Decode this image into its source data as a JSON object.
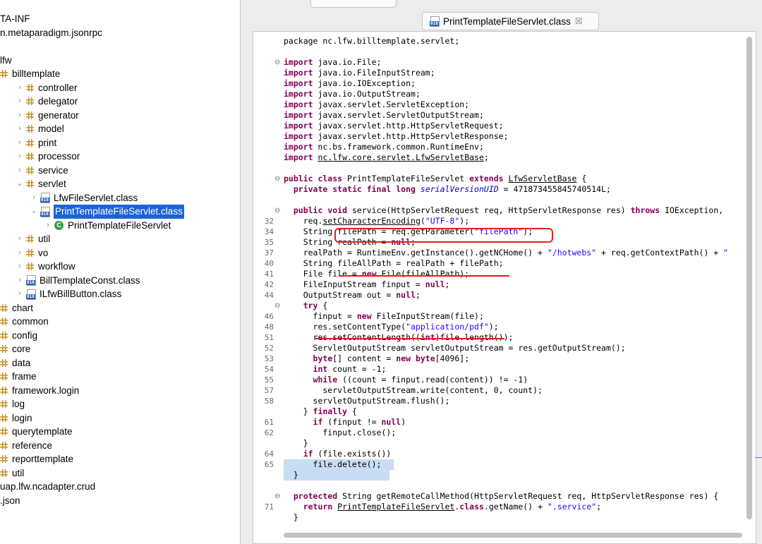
{
  "explorer": {
    "items": [
      {
        "label": "TA-INF",
        "indent": 0,
        "chev": "",
        "icon": "none"
      },
      {
        "label": "n.metaparadigm.jsonrpc",
        "indent": 0,
        "chev": "",
        "icon": "none"
      },
      {
        "label": "",
        "indent": 0,
        "chev": "",
        "icon": "none"
      },
      {
        "label": "lfw",
        "indent": 0,
        "chev": "",
        "icon": "none"
      },
      {
        "label": "billtemplate",
        "indent": 0,
        "chev": "",
        "icon": "pkg"
      },
      {
        "label": "controller",
        "indent": 1,
        "chev": ">",
        "icon": "pkg"
      },
      {
        "label": "delegator",
        "indent": 1,
        "chev": ">",
        "icon": "pkg"
      },
      {
        "label": "generator",
        "indent": 1,
        "chev": ">",
        "icon": "pkg"
      },
      {
        "label": "model",
        "indent": 1,
        "chev": ">",
        "icon": "pkg"
      },
      {
        "label": "print",
        "indent": 1,
        "chev": ">",
        "icon": "pkg"
      },
      {
        "label": "processor",
        "indent": 1,
        "chev": ">",
        "icon": "pkg"
      },
      {
        "label": "service",
        "indent": 1,
        "chev": ">",
        "icon": "pkg"
      },
      {
        "label": "servlet",
        "indent": 1,
        "chev": "v",
        "icon": "pkg"
      },
      {
        "label": "LfwFileServlet.class",
        "indent": 2,
        "chev": ">",
        "icon": "class"
      },
      {
        "label": "PrintTemplateFileServlet.class",
        "indent": 2,
        "chev": "v",
        "icon": "class",
        "selected": true
      },
      {
        "label": "PrintTemplateFileServlet",
        "indent": 3,
        "chev": ">",
        "icon": "cls"
      },
      {
        "label": "util",
        "indent": 1,
        "chev": ">",
        "icon": "pkg"
      },
      {
        "label": "vo",
        "indent": 1,
        "chev": ">",
        "icon": "pkg"
      },
      {
        "label": "workflow",
        "indent": 1,
        "chev": ">",
        "icon": "pkg"
      },
      {
        "label": "BillTemplateConst.class",
        "indent": 1,
        "chev": ">",
        "icon": "class"
      },
      {
        "label": "ILfwBillButton.class",
        "indent": 1,
        "chev": ">",
        "icon": "class"
      },
      {
        "label": "chart",
        "indent": 0,
        "chev": "",
        "icon": "pkg"
      },
      {
        "label": "common",
        "indent": 0,
        "chev": "",
        "icon": "pkg"
      },
      {
        "label": "config",
        "indent": 0,
        "chev": "",
        "icon": "pkg"
      },
      {
        "label": "core",
        "indent": 0,
        "chev": "",
        "icon": "pkg"
      },
      {
        "label": "data",
        "indent": 0,
        "chev": "",
        "icon": "pkg"
      },
      {
        "label": "frame",
        "indent": 0,
        "chev": "",
        "icon": "pkg"
      },
      {
        "label": "framework.login",
        "indent": 0,
        "chev": "",
        "icon": "pkg"
      },
      {
        "label": "log",
        "indent": 0,
        "chev": "",
        "icon": "pkg"
      },
      {
        "label": "login",
        "indent": 0,
        "chev": "",
        "icon": "pkg"
      },
      {
        "label": "querytemplate",
        "indent": 0,
        "chev": "",
        "icon": "pkg"
      },
      {
        "label": "reference",
        "indent": 0,
        "chev": "",
        "icon": "pkg"
      },
      {
        "label": "reporttemplate",
        "indent": 0,
        "chev": "",
        "icon": "pkg"
      },
      {
        "label": "util",
        "indent": 0,
        "chev": "",
        "icon": "pkg"
      },
      {
        "label": "uap.lfw.ncadapter.crud",
        "indent": 0,
        "chev": "",
        "icon": "none"
      },
      {
        "label": ".json",
        "indent": 0,
        "chev": "",
        "icon": "none"
      }
    ]
  },
  "editor": {
    "tab_label": "PrintTemplateFileServlet.class",
    "tab_close": "☒",
    "lines": [
      {
        "n": "",
        "fold": "",
        "code": [
          [
            "",
            "package nc.lfw.billtemplate.servlet;"
          ]
        ]
      },
      {
        "n": "",
        "fold": "",
        "code": []
      },
      {
        "n": "",
        "fold": "⊖",
        "code": [
          [
            "kw",
            "import"
          ],
          [
            "",
            " java.io.File;"
          ]
        ]
      },
      {
        "n": "",
        "fold": "",
        "code": [
          [
            "kw",
            "import"
          ],
          [
            "",
            " java.io.FileInputStream;"
          ]
        ]
      },
      {
        "n": "",
        "fold": "",
        "code": [
          [
            "kw",
            "import"
          ],
          [
            "",
            " java.io.IOException;"
          ]
        ]
      },
      {
        "n": "",
        "fold": "",
        "code": [
          [
            "kw",
            "import"
          ],
          [
            "",
            " java.io.OutputStream;"
          ]
        ]
      },
      {
        "n": "",
        "fold": "",
        "code": [
          [
            "kw",
            "import"
          ],
          [
            "",
            " javax.servlet.ServletException;"
          ]
        ]
      },
      {
        "n": "",
        "fold": "",
        "code": [
          [
            "kw",
            "import"
          ],
          [
            "",
            " javax.servlet.ServletOutputStream;"
          ]
        ]
      },
      {
        "n": "",
        "fold": "",
        "code": [
          [
            "kw",
            "import"
          ],
          [
            "",
            " javax.servlet.http.HttpServletRequest;"
          ]
        ]
      },
      {
        "n": "",
        "fold": "",
        "code": [
          [
            "kw",
            "import"
          ],
          [
            "",
            " javax.servlet.http.HttpServletResponse;"
          ]
        ]
      },
      {
        "n": "",
        "fold": "",
        "code": [
          [
            "kw",
            "import"
          ],
          [
            "",
            " nc.bs.framework.common.RuntimeEnv;"
          ]
        ]
      },
      {
        "n": "",
        "fold": "",
        "code": [
          [
            "kw",
            "import"
          ],
          [
            "",
            " "
          ],
          [
            "ul",
            "nc.lfw.core.servlet.LfwServletBase"
          ],
          [
            "",
            ";"
          ]
        ]
      },
      {
        "n": "",
        "fold": "",
        "code": []
      },
      {
        "n": "",
        "fold": "⊖",
        "code": [
          [
            "kw",
            "public class"
          ],
          [
            "",
            " PrintTemplateFileServlet "
          ],
          [
            "kw",
            "extends"
          ],
          [
            "",
            " "
          ],
          [
            "ul",
            "LfwServletBase"
          ],
          [
            "",
            " {"
          ]
        ]
      },
      {
        "n": "",
        "fold": "",
        "code": [
          [
            "",
            "  "
          ],
          [
            "kw",
            "private static final long"
          ],
          [
            "",
            " "
          ],
          [
            "fld",
            "serialVersionUID"
          ],
          [
            "",
            " = 471873455845740514L;"
          ]
        ]
      },
      {
        "n": "",
        "fold": "",
        "code": []
      },
      {
        "n": "",
        "fold": "⊖",
        "code": [
          [
            "",
            "  "
          ],
          [
            "kw",
            "public void"
          ],
          [
            "",
            " service(HttpServletRequest req, HttpServletResponse res) "
          ],
          [
            "kw",
            "throws"
          ],
          [
            "",
            " IOException,"
          ]
        ]
      },
      {
        "n": "32",
        "fold": "",
        "code": [
          [
            "",
            "    req."
          ],
          [
            "ul",
            "setCharacterEncoding"
          ],
          [
            "",
            "("
          ],
          [
            "str",
            "\"UTF-8\""
          ],
          [
            "",
            ");"
          ]
        ]
      },
      {
        "n": "34",
        "fold": "",
        "code": [
          [
            "",
            "    String filePath = req.getParameter("
          ],
          [
            "str",
            "\"filePath\""
          ],
          [
            "",
            ");"
          ]
        ]
      },
      {
        "n": "35",
        "fold": "",
        "code": [
          [
            "",
            "    String realPath = "
          ],
          [
            "kw",
            "null"
          ],
          [
            "",
            ";"
          ]
        ]
      },
      {
        "n": "37",
        "fold": "",
        "code": [
          [
            "",
            "    realPath = RuntimeEnv.getInstance().getNCHome() + "
          ],
          [
            "str",
            "\"/hotwebs\""
          ],
          [
            "",
            " + req.getContextPath() + "
          ],
          [
            "str",
            "\""
          ]
        ]
      },
      {
        "n": "40",
        "fold": "",
        "code": [
          [
            "",
            "    String fileAllPath = realPath + filePath;"
          ]
        ]
      },
      {
        "n": "41",
        "fold": "",
        "code": [
          [
            "",
            "    File file = "
          ],
          [
            "kw",
            "new"
          ],
          [
            "",
            " File(fileAllPath);"
          ]
        ]
      },
      {
        "n": "42",
        "fold": "",
        "code": [
          [
            "",
            "    FileInputStream finput = "
          ],
          [
            "kw",
            "null"
          ],
          [
            "",
            ";"
          ]
        ]
      },
      {
        "n": "44",
        "fold": "",
        "code": [
          [
            "",
            "    OutputStream out = "
          ],
          [
            "kw",
            "null"
          ],
          [
            "",
            ";"
          ]
        ]
      },
      {
        "n": "",
        "fold": "⊖",
        "code": [
          [
            "",
            "    "
          ],
          [
            "kw",
            "try"
          ],
          [
            "",
            " {"
          ]
        ]
      },
      {
        "n": "46",
        "fold": "",
        "code": [
          [
            "",
            "      finput = "
          ],
          [
            "kw",
            "new"
          ],
          [
            "",
            " FileInputStream(file);"
          ]
        ]
      },
      {
        "n": "48",
        "fold": "",
        "code": [
          [
            "",
            "      res.setContentType("
          ],
          [
            "str",
            "\"application/pdf\""
          ],
          [
            "",
            ");"
          ]
        ]
      },
      {
        "n": "51",
        "fold": "",
        "code": [
          [
            "",
            "      res.setContentLength(("
          ],
          [
            "kw",
            "int"
          ],
          [
            "",
            ")file.length());"
          ]
        ]
      },
      {
        "n": "52",
        "fold": "",
        "code": [
          [
            "",
            "      ServletOutputStream servletOutputStream = res.getOutputStream();"
          ]
        ]
      },
      {
        "n": "53",
        "fold": "",
        "code": [
          [
            "",
            "      "
          ],
          [
            "kw",
            "byte"
          ],
          [
            "",
            "[] content = "
          ],
          [
            "kw",
            "new byte"
          ],
          [
            "",
            "[4096];"
          ]
        ]
      },
      {
        "n": "54",
        "fold": "",
        "code": [
          [
            "",
            "      "
          ],
          [
            "kw",
            "int"
          ],
          [
            "",
            " count = -1;"
          ]
        ]
      },
      {
        "n": "55",
        "fold": "",
        "code": [
          [
            "",
            "      "
          ],
          [
            "kw",
            "while"
          ],
          [
            "",
            " ((count = finput.read(content)) != -1)"
          ]
        ]
      },
      {
        "n": "57",
        "fold": "",
        "code": [
          [
            "",
            "        servletOutputStream.write(content, 0, count);"
          ]
        ]
      },
      {
        "n": "58",
        "fold": "",
        "code": [
          [
            "",
            "      servletOutputStream.flush();"
          ]
        ]
      },
      {
        "n": "",
        "fold": "",
        "code": [
          [
            "",
            "    } "
          ],
          [
            "kw",
            "finally"
          ],
          [
            "",
            " {"
          ]
        ]
      },
      {
        "n": "61",
        "fold": "",
        "code": [
          [
            "",
            "      "
          ],
          [
            "kw",
            "if"
          ],
          [
            "",
            " (finput != "
          ],
          [
            "kw",
            "null"
          ],
          [
            "",
            ")"
          ]
        ]
      },
      {
        "n": "62",
        "fold": "",
        "code": [
          [
            "",
            "        finput.close();"
          ]
        ]
      },
      {
        "n": "",
        "fold": "",
        "code": [
          [
            "",
            "    }"
          ]
        ]
      },
      {
        "n": "64",
        "fold": "",
        "code": [
          [
            "",
            "    "
          ],
          [
            "kw",
            "if"
          ],
          [
            "",
            " (file.exists())"
          ]
        ]
      },
      {
        "n": "65",
        "fold": "",
        "code": [
          [
            "",
            "      file.delete();"
          ]
        ]
      },
      {
        "n": "",
        "fold": "",
        "code": [
          [
            "",
            "  }"
          ]
        ]
      },
      {
        "n": "",
        "fold": "",
        "code": []
      },
      {
        "n": "",
        "fold": "⊖",
        "code": [
          [
            "",
            "  "
          ],
          [
            "kw",
            "protected"
          ],
          [
            "",
            " String getRemoteCallMethod(HttpServletRequest req, HttpServletResponse res) {"
          ]
        ]
      },
      {
        "n": "71",
        "fold": "",
        "code": [
          [
            "",
            "    "
          ],
          [
            "kw",
            "return"
          ],
          [
            "",
            " "
          ],
          [
            "ul",
            "PrintTemplateFileServlet"
          ],
          [
            "",
            "."
          ],
          [
            "kw",
            "class"
          ],
          [
            "",
            ".getName() + "
          ],
          [
            "str",
            "\".service\""
          ],
          [
            "",
            ";"
          ]
        ]
      },
      {
        "n": "",
        "fold": "",
        "code": [
          [
            "",
            "  }"
          ]
        ]
      }
    ]
  }
}
